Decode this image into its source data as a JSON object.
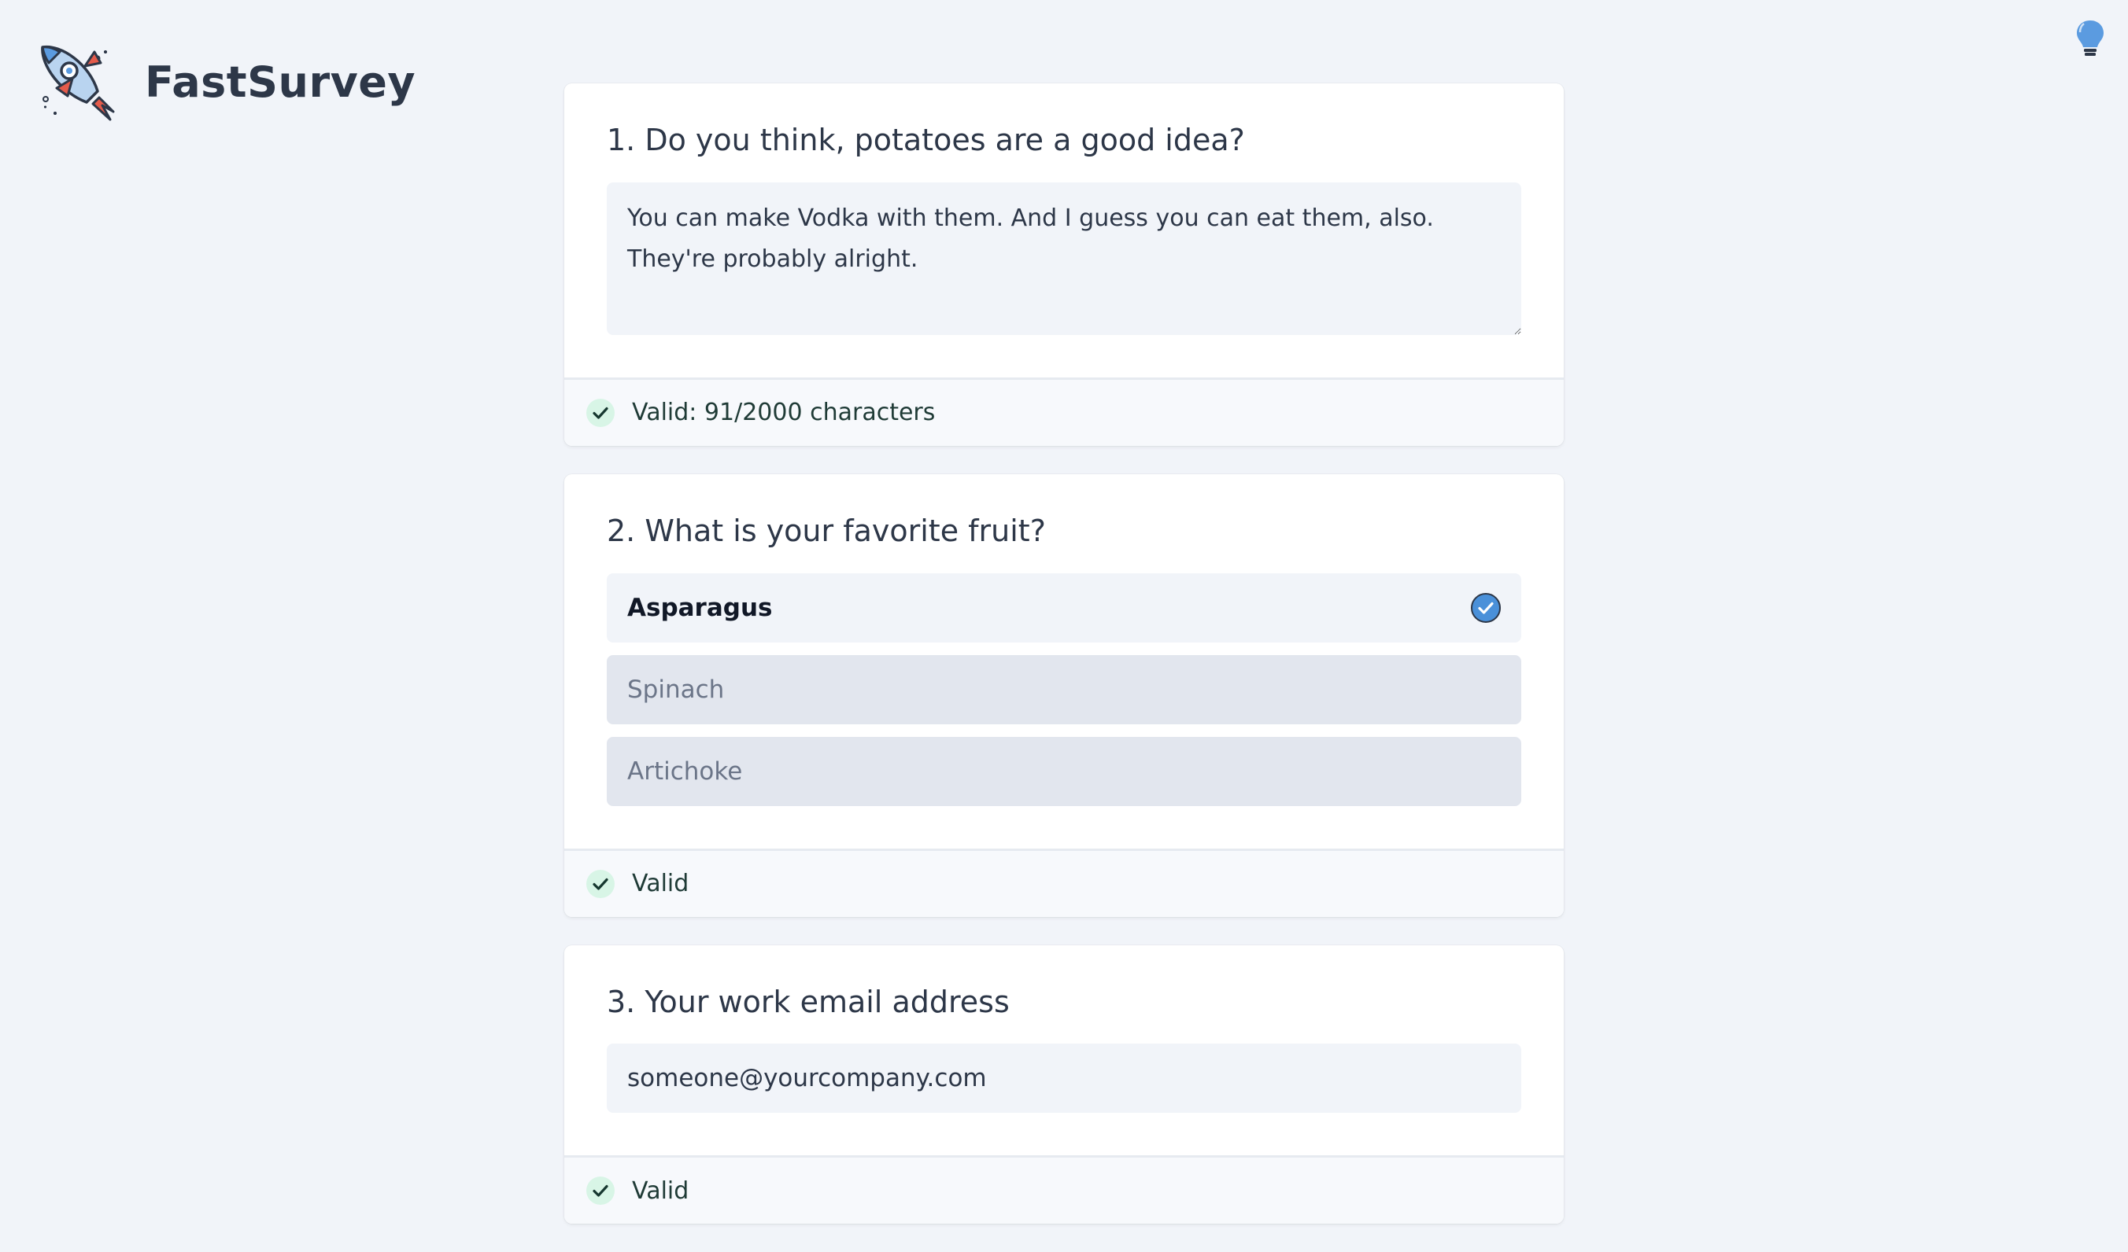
{
  "header": {
    "app_name": "FastSurvey"
  },
  "icons": {
    "logo": "rocket-logo",
    "theme_toggle": "lightbulb-icon",
    "valid": "check-circle-icon",
    "selected": "check-badge-icon"
  },
  "colors": {
    "accent": "#4a90d9",
    "valid_green": "#1f8a5a",
    "valid_bg": "#d8f5e6",
    "background": "#f1f4f9"
  },
  "questions": [
    {
      "title": "1. Do you think, potatoes are a good idea?",
      "answer": "You can make Vodka with them. And I guess you can eat them, also. They're probably alright.",
      "status": "Valid: 91/2000 characters"
    },
    {
      "title": "2. What is your favorite fruit?",
      "options": [
        {
          "label": "Asparagus",
          "selected": true
        },
        {
          "label": "Spinach",
          "selected": false
        },
        {
          "label": "Artichoke",
          "selected": false
        }
      ],
      "status": "Valid"
    },
    {
      "title": "3. Your work email address",
      "answer": "someone@yourcompany.com",
      "status": "Valid"
    }
  ]
}
